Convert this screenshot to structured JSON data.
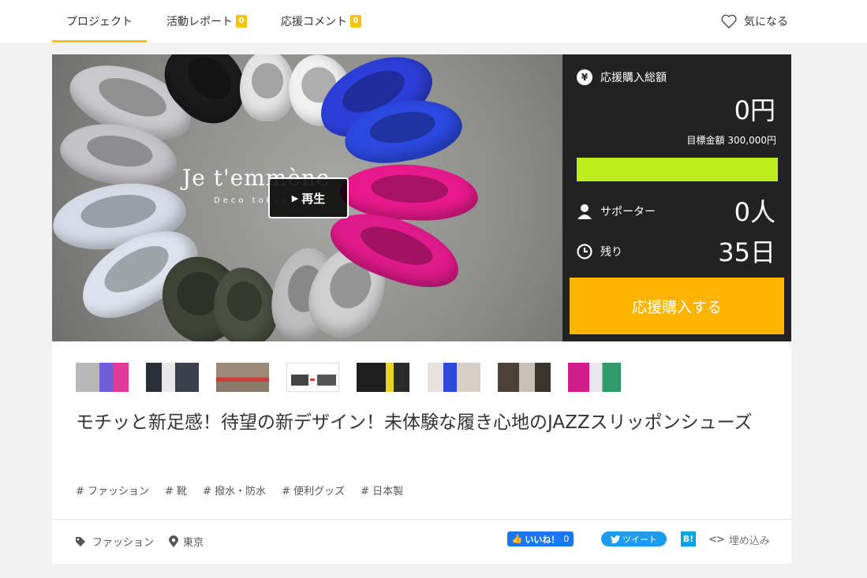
{
  "nav": {
    "tabs": [
      {
        "label": "プロジェクト"
      },
      {
        "label": "活動レポート",
        "badge": "0"
      },
      {
        "label": "応援コメント",
        "badge": "0"
      }
    ],
    "favorite_label": "気になる"
  },
  "hero": {
    "logo_text": "Je t'emmène",
    "logo_subtext": "Deco tokyo",
    "play_label": "再生"
  },
  "panel": {
    "total_label": "応援購入総額",
    "total_value": "0円",
    "goal_text": "目標金額 300,000円",
    "progress_fraction": 1.0,
    "supporters_label": "サポーター",
    "supporters_value": "0人",
    "remaining_label": "残り",
    "remaining_value": "35日",
    "buy_label": "応援購入する"
  },
  "title": "モチッと新足感！待望の新デザイン！未体験な履き心地のJAZZスリッポンシューズ",
  "tags": [
    "# ファッション",
    "# 靴",
    "# 撥水・防水",
    "# 便利グッズ",
    "# 日本製"
  ],
  "footer": {
    "category": "ファッション",
    "location": "東京",
    "like_label": "いいね！",
    "like_count": "0",
    "tweet_label": "ツイート",
    "hatena_label": "B!",
    "embed_label": "埋め込み"
  },
  "colors": {
    "accent": "#f5c400",
    "buy_button": "#ffb400",
    "progress": "#bcee1c",
    "panel_bg": "#222222"
  }
}
